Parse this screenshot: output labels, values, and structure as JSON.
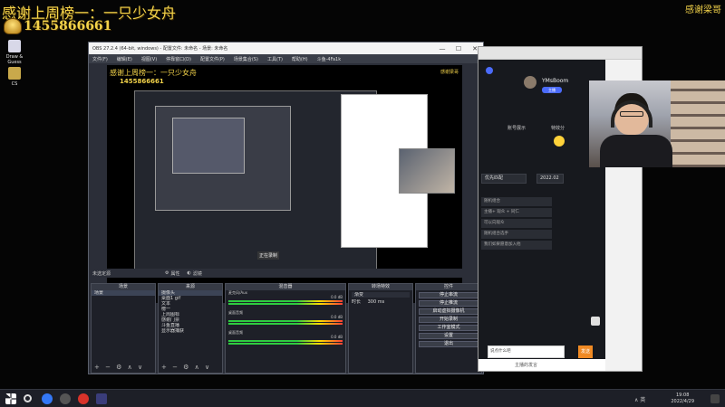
{
  "overlay": {
    "thanks_text": "感谢上周榜一：一只少女舟",
    "viewer_id": "1455866661",
    "brand_text": "感谢梁哥"
  },
  "desktop": {
    "icons": [
      {
        "label": "Draw & Guess",
        "icon": "draw-guess-icon",
        "color": "#d8d8e8"
      },
      {
        "label": "CS",
        "icon": "cs-game-icon",
        "color": "#c9a94b"
      }
    ]
  },
  "obs": {
    "window_title": "OBS 27.2.4 (64-bit, windows) - 配置文件: 未命名 - 场景: 未命名",
    "minimize": "—",
    "maximize": "☐",
    "close": "✕",
    "menus": [
      "文件(F)",
      "编辑(E)",
      "视图(V)",
      "停靠窗口(D)",
      "配置文件(P)",
      "场景集合(S)",
      "工具(T)",
      "帮助(H)",
      "斗鱼-4Fa1k"
    ],
    "preview": {
      "thanks_text": "感谢上周榜一：一只少女舟",
      "viewer_id": "1455866661",
      "brand_text": "感谢梁哥",
      "source_label": "正在录制"
    },
    "status": {
      "no_source": "未选定源",
      "properties": "属性",
      "filters": "滤镜"
    },
    "docks": {
      "scenes": {
        "title": "场景",
        "items": [
          "场景"
        ]
      },
      "sources": {
        "title": "来源",
        "items": [
          "摄像头",
          "桌面1 gif",
          "文本",
          "榜一",
          "上周图标",
          "感谢门票",
          "斗鱼直播",
          "显示器捕获"
        ]
      },
      "mixer": {
        "title": "混音器",
        "channels": [
          {
            "name": "麦克风/Aux",
            "db": "0.0 dB"
          },
          {
            "name": "桌面音频",
            "db": "0.0 dB"
          },
          {
            "name": "桌面音频",
            "db": "0.0 dB"
          }
        ]
      },
      "transitions": {
        "title": "转场特效",
        "type": "渐变",
        "duration_label": "时长",
        "duration": "300 ms"
      },
      "controls": {
        "title": "控件",
        "buttons": [
          "停止串流",
          "停止推流",
          "启动虚拟摄像机",
          "开始录制",
          "工作室模式",
          "设置",
          "退出"
        ]
      }
    },
    "footer_controls": "+ − ⚙ ∧ ∨"
  },
  "browser": {
    "username": "YMsBoom",
    "badge": "主播",
    "labels": {
      "hotkey": "账号展示",
      "emote": "特效分",
      "select_label": "优先匹配",
      "month": "2022.02"
    },
    "rows": [
      "随机组合",
      "主播+ 观众 + 同仁",
      "可以向观众",
      "随机组合选手",
      "我们如果愿意加入他"
    ],
    "chat_placeholder": "说点什么吧",
    "send": "发送",
    "bottom_text": "主播的发言"
  },
  "taskbar": {
    "time": "19:08",
    "date": "2022/4/29",
    "tray_text": "∧ 英"
  }
}
